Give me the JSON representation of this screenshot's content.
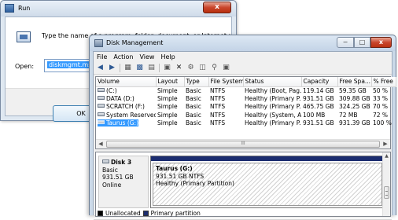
{
  "run": {
    "title": "Run",
    "close_glyph": "x",
    "description": "Type the name of a program, folder, document, or Internet resource, and Windows will open it for you.",
    "open_label": "Open:",
    "open_value": "diskmgmt.msc",
    "ok_label": "OK"
  },
  "dm": {
    "title": "Disk Management",
    "min_glyph": "−",
    "max_glyph": "□",
    "close_glyph": "x",
    "menu": [
      "File",
      "Action",
      "View",
      "Help"
    ],
    "toolbar_icons": [
      "back-arrow-icon",
      "forward-arrow-icon",
      "console-tree-icon",
      "help-icon",
      "grid-icon",
      "properties-icon",
      "delete-icon",
      "settings-icon",
      "open-folder-icon",
      "search-icon",
      "disk-icon"
    ],
    "columns": [
      "Volume",
      "Layout",
      "Type",
      "File System",
      "Status",
      "Capacity",
      "Free Spa...",
      "% Free"
    ],
    "volumes": [
      {
        "volume": "(C:)",
        "layout": "Simple",
        "type": "Basic",
        "fs": "NTFS",
        "status": "Healthy (Boot, Pag...",
        "capacity": "119.14 GB",
        "free": "59.35 GB",
        "pct": "50 %"
      },
      {
        "volume": "DATA (D:)",
        "layout": "Simple",
        "type": "Basic",
        "fs": "NTFS",
        "status": "Healthy (Primary P...",
        "capacity": "931.51 GB",
        "free": "309.88 GB",
        "pct": "33 %"
      },
      {
        "volume": "SCRATCH (F:)",
        "layout": "Simple",
        "type": "Basic",
        "fs": "NTFS",
        "status": "Healthy (Primary P...",
        "capacity": "465.75 GB",
        "free": "324.25 GB",
        "pct": "70 %"
      },
      {
        "volume": "System Reserved",
        "layout": "Simple",
        "type": "Basic",
        "fs": "NTFS",
        "status": "Healthy (System, A...",
        "capacity": "100 MB",
        "free": "72 MB",
        "pct": "72 %"
      },
      {
        "volume": "Taurus (G:)",
        "layout": "Simple",
        "type": "Basic",
        "fs": "NTFS",
        "status": "Healthy (Primary P...",
        "capacity": "931.51 GB",
        "free": "931.39 GB",
        "pct": "100 %"
      }
    ],
    "selected_row": 4,
    "hscroll_grip": "III",
    "disk": {
      "name": "Disk 3",
      "type": "Basic",
      "size": "931.51 GB",
      "state": "Online"
    },
    "partition": {
      "name": "Taurus  (G:)",
      "size_fs": "931.51 GB NTFS",
      "status": "Healthy (Primary Partition)"
    },
    "legend": [
      "Unallocated",
      "Primary partition"
    ],
    "colors": {
      "primary_partition": "#1c2d70",
      "unallocated": "#000000",
      "selection": "#3399ff"
    }
  }
}
